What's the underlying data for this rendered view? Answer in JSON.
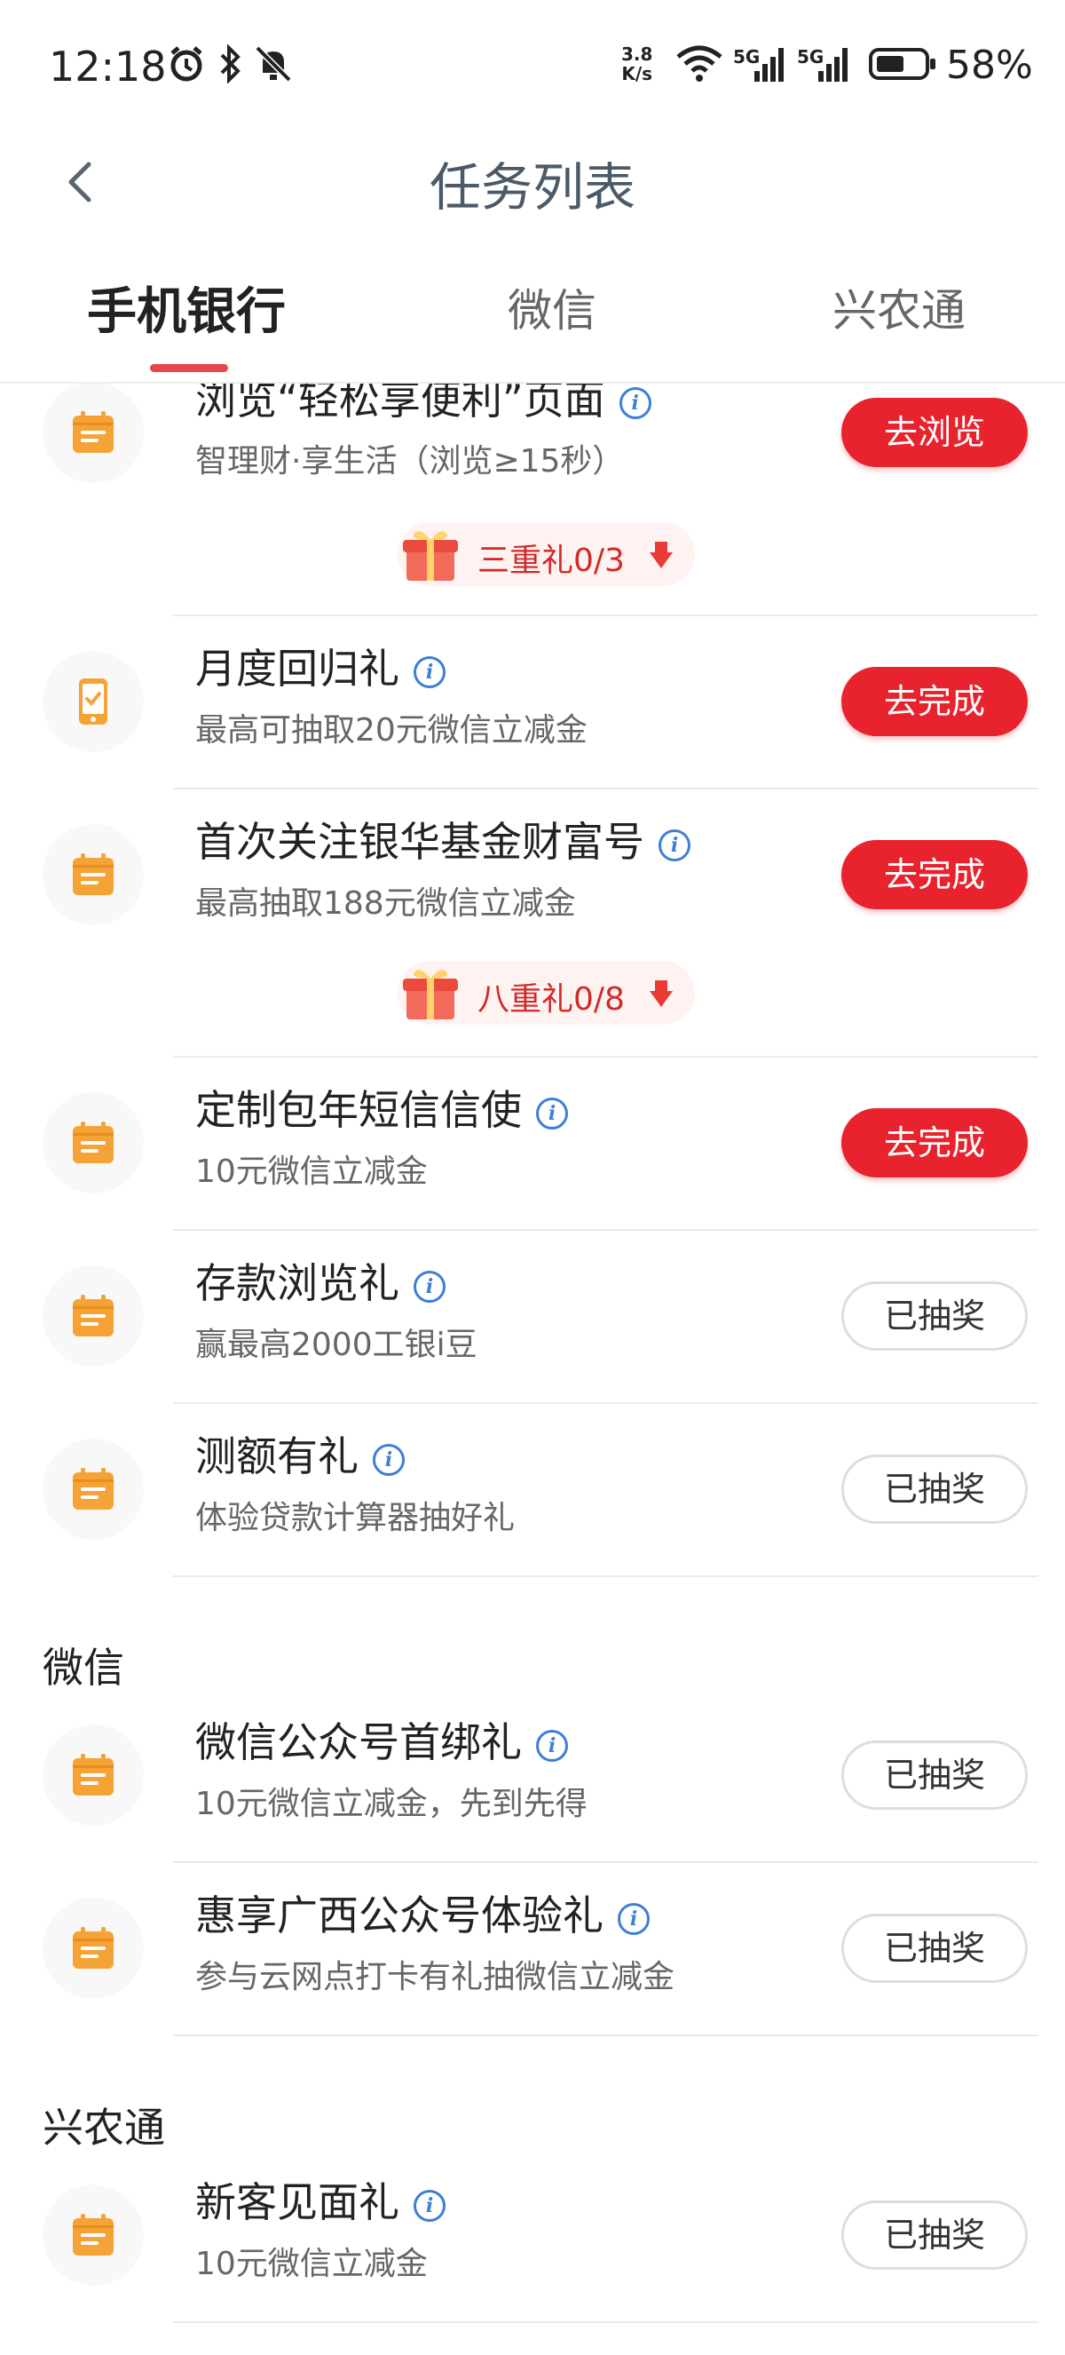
{
  "status_bar": {
    "time": "12:18",
    "net_speed_value": "3.8",
    "net_speed_unit": "K/s",
    "signal1": "5G",
    "signal2": "5G",
    "battery": "58%"
  },
  "header": {
    "title": "任务列表"
  },
  "tabs": [
    {
      "label": "手机银行",
      "active": true
    },
    {
      "label": "微信"
    },
    {
      "label": "兴农通"
    }
  ],
  "tasks": [
    {
      "title": "浏览“轻松享便利”页面",
      "subtitle": "智理财·享生活（浏览≥15秒）",
      "button": "去浏览",
      "icon": "calendar-icon"
    },
    {
      "title": "月度回归礼",
      "subtitle": "最高可抽取20元微信立减金",
      "button": "去完成",
      "icon": "phone-check-icon"
    },
    {
      "title": "首次关注银华基金财富号",
      "subtitle": "最高抽取188元微信立减金",
      "button": "去完成",
      "icon": "calendar-icon"
    },
    {
      "title": "定制包年短信信使",
      "subtitle": "10元微信立减金",
      "button": "去完成",
      "icon": "calendar-icon"
    },
    {
      "title": "存款浏览礼",
      "subtitle": "赢最高2000工银i豆",
      "button": "已抽奖",
      "icon": "calendar-icon"
    },
    {
      "title": "测额有礼",
      "subtitle": "体验贷款计算器抽好礼",
      "button": "已抽奖",
      "icon": "calendar-icon"
    }
  ],
  "bundles": [
    {
      "label": "三重礼0/3"
    },
    {
      "label": "八重礼0/8"
    }
  ],
  "sections": [
    {
      "title": "微信",
      "tasks": [
        {
          "title": "微信公众号首绑礼",
          "subtitle": "10元微信立减金，先到先得",
          "button": "已抽奖",
          "icon": "calendar-icon"
        },
        {
          "title": "惠享广西公众号体验礼",
          "subtitle": "参与云网点打卡有礼抽微信立减金",
          "button": "已抽奖",
          "icon": "calendar-icon"
        }
      ]
    },
    {
      "title": "兴农通",
      "tasks": [
        {
          "title": "新客见面礼",
          "subtitle": "10元微信立减金",
          "button": "已抽奖",
          "icon": "calendar-icon"
        }
      ]
    }
  ],
  "colors": {
    "accent_red": "#e8232e",
    "icon_orange": "#f5a236",
    "info_blue": "#3d7fd6"
  }
}
